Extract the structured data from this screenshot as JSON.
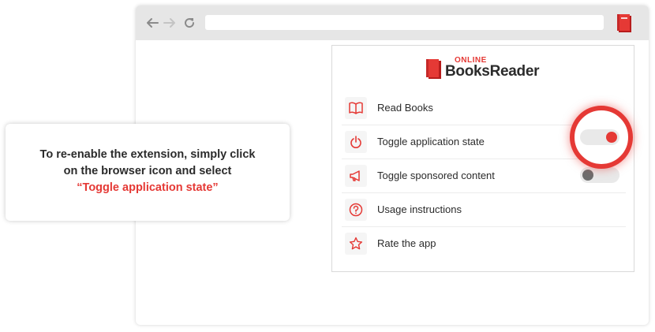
{
  "colors": {
    "accent": "#e53935",
    "text": "#2b2b2b",
    "toggle_off": "#6d6d6d",
    "toggle_track": "#e9e9e9"
  },
  "browser": {
    "nav_icons": [
      "back-arrow-icon",
      "forward-arrow-icon",
      "reload-icon"
    ],
    "address_bar": {
      "value": ""
    },
    "extension_icon": "book-icon"
  },
  "popup": {
    "logo": {
      "small": "ONLINE",
      "main": "BooksReader"
    },
    "menu": [
      {
        "label": "Read Books",
        "icon": "book-open-icon"
      },
      {
        "label": "Toggle application state",
        "icon": "power-icon",
        "toggle": true,
        "state": "on"
      },
      {
        "label": "Toggle sponsored content",
        "icon": "megaphone-icon",
        "toggle": true,
        "state": "off"
      },
      {
        "label": "Usage instructions",
        "icon": "question-icon"
      },
      {
        "label": "Rate the app",
        "icon": "star-icon"
      }
    ]
  },
  "callout": {
    "line1": "To re-enable the extension, simply click",
    "line2": "on the browser icon and select",
    "highlight": "“Toggle application state”"
  }
}
